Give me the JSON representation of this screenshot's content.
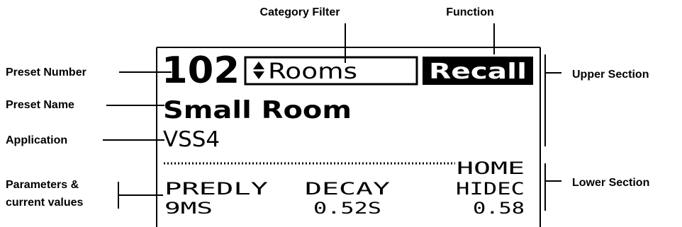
{
  "callouts": {
    "category_filter": "Category Filter",
    "function": "Function",
    "preset_number": "Preset Number",
    "preset_name": "Preset Name",
    "application": "Application",
    "parameters_line1": "Parameters &",
    "parameters_line2": "current values",
    "upper_section": "Upper Section",
    "lower_section": "Lower Section"
  },
  "display": {
    "preset_number": "102",
    "category": "Rooms",
    "category_arrows_icon": "up-down-arrows-icon",
    "function_label": "Recall",
    "preset_name": "Small Room",
    "application": "VSS4",
    "page_label": "HOME",
    "parameters": [
      {
        "name": "PREDLY",
        "value": "9MS"
      },
      {
        "name": "DECAY",
        "value": "0.52S"
      },
      {
        "name": "HIDEC",
        "value": "0.58"
      }
    ]
  }
}
